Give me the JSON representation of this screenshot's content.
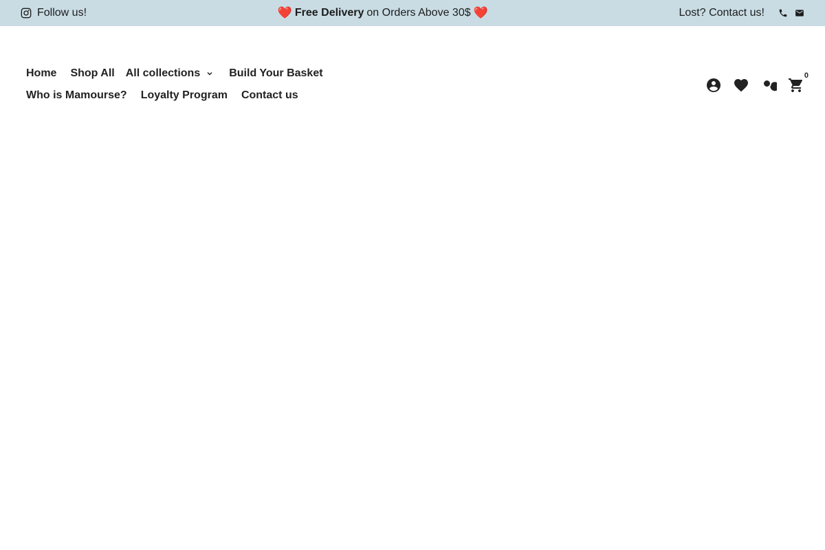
{
  "topbar": {
    "follow_text": "Follow us!",
    "promo_bold": "Free Delivery",
    "promo_rest": "on Orders Above 30$",
    "heart_left": "❤️",
    "heart_right": "❤️",
    "contact_text": "Lost? Contact us!",
    "bg_color": "#c9dce4"
  },
  "nav": {
    "row1": [
      "Home",
      "Shop All",
      "All collections",
      "Build Your Basket"
    ],
    "row2": [
      "Who is Mamourse?",
      "Loyalty Program",
      "Contact us"
    ]
  },
  "header_icons": {
    "cart_count": "0"
  }
}
